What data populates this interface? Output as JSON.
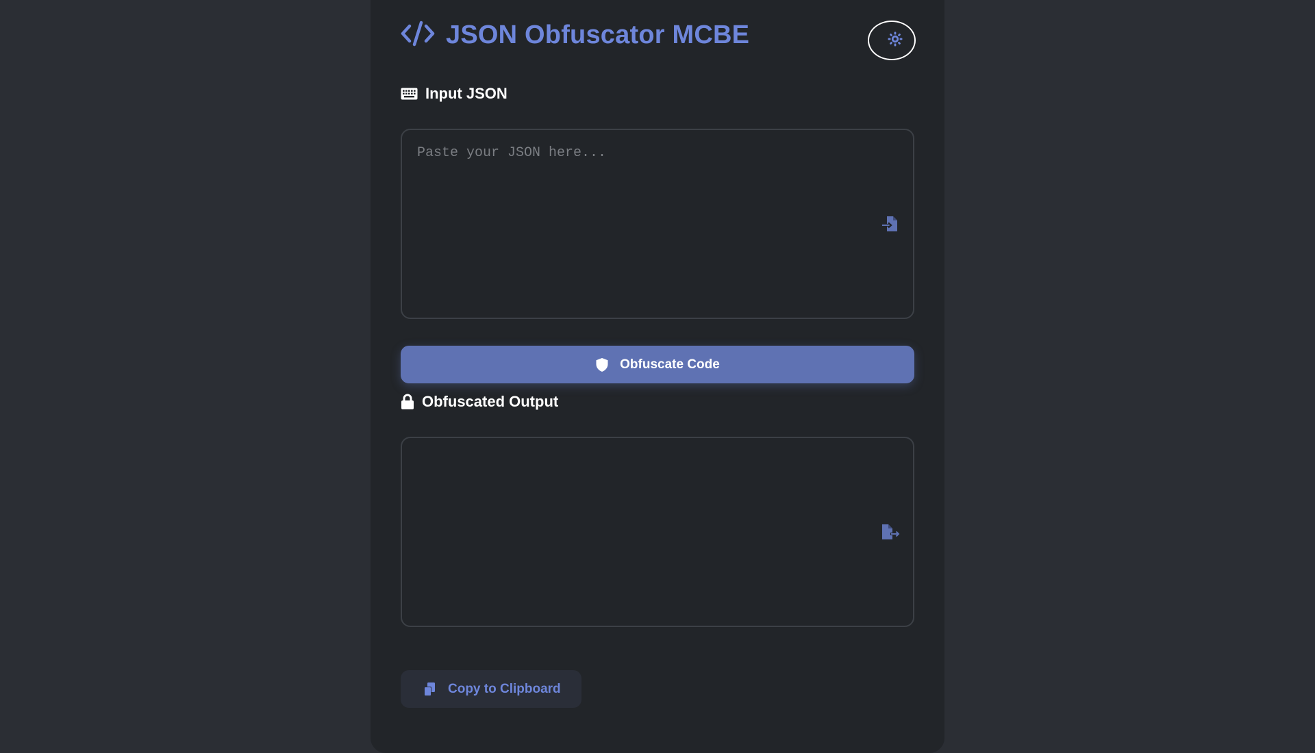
{
  "header": {
    "title": "JSON Obfuscator MCBE",
    "logo_icon": "code-icon",
    "theme_toggle_icon": "sun-icon"
  },
  "input_section": {
    "label": "Input JSON",
    "label_icon": "keyboard-icon",
    "placeholder": "Paste your JSON here...",
    "value": "",
    "side_icon": "file-import-icon"
  },
  "obfuscate_button": {
    "label": "Obfuscate Code",
    "icon": "shield-icon"
  },
  "output_section": {
    "label": "Obfuscated Output",
    "label_icon": "lock-icon",
    "value": "",
    "side_icon": "file-export-icon"
  },
  "copy_button": {
    "label": "Copy to Clipboard",
    "icon": "copy-icon"
  },
  "colors": {
    "page_background": "#2b2e34",
    "card_background": "#222529",
    "accent": "#6e86db",
    "button_primary": "#5f72b3",
    "text_primary": "#ffffff",
    "border": "#3c4046"
  }
}
